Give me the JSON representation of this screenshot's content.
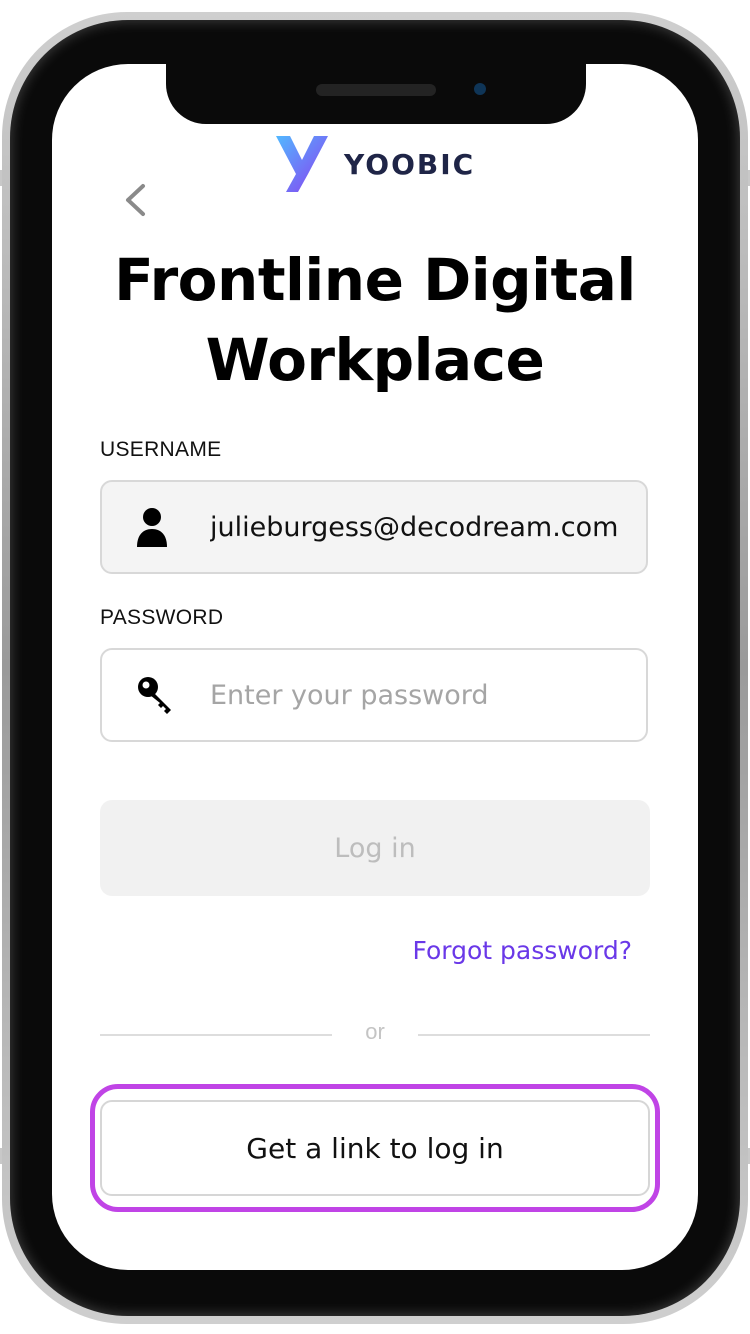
{
  "brand": {
    "name": "YOOBIC",
    "logo_icon": "yoobic-y-logo-icon",
    "logo_gradient_start": "#4fb3ff",
    "logo_gradient_end": "#8a3cf0",
    "text_color": "#1f2547"
  },
  "navigation": {
    "back_icon": "chevron-left-icon"
  },
  "title": {
    "line1": "Frontline Digital",
    "line2": "Workplace"
  },
  "username": {
    "label": "USERNAME",
    "value": "julieburgess@decodream.com",
    "icon": "user-icon"
  },
  "password": {
    "label": "PASSWORD",
    "placeholder": "Enter your password",
    "icon": "key-icon"
  },
  "actions": {
    "login_label": "Log in",
    "forgot_label": "Forgot password?",
    "or_label": "or",
    "link_label": "Get a link to log in"
  },
  "colors": {
    "accent": "#6a38e8",
    "highlight": "#c044e6",
    "disabled_text": "#bdbdbd"
  }
}
